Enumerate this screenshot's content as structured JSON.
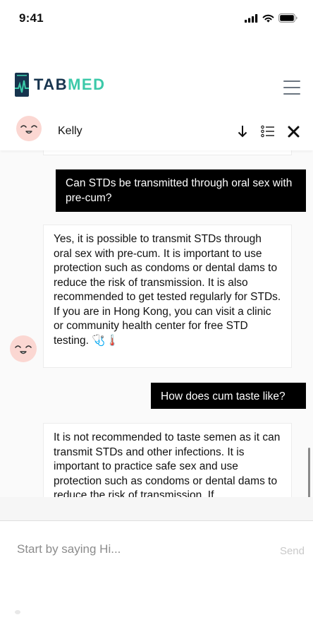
{
  "status_bar": {
    "time": "9:41"
  },
  "header": {
    "logo_text_primary": "TAB",
    "logo_text_accent": "MED",
    "accent_color": "#3cc9a9",
    "brand_color": "#17344e"
  },
  "chat": {
    "agent_name": "Kelly",
    "messages": [
      {
        "role": "user",
        "text": "Can STDs be transmitted through oral sex with pre-cum?"
      },
      {
        "role": "bot",
        "text": "Yes, it is possible to transmit STDs through oral sex with pre-cum. It is important to use protection such as condoms or dental dams to reduce the risk of transmission. It is also recommended to get tested regularly for STDs. If you are in Hong Kong, you can visit a clinic or community health center for free STD testing. 🩺🌡️"
      },
      {
        "role": "user",
        "text": "How does cum taste like?"
      },
      {
        "role": "bot",
        "text": "It is not recommended to taste semen as it can transmit STDs and other infections. It is important to practice safe sex and use protection such as condoms or dental dams to reduce the risk of transmission. If"
      }
    ]
  },
  "input": {
    "placeholder": "Start by saying Hi...",
    "send_label": "Send"
  }
}
